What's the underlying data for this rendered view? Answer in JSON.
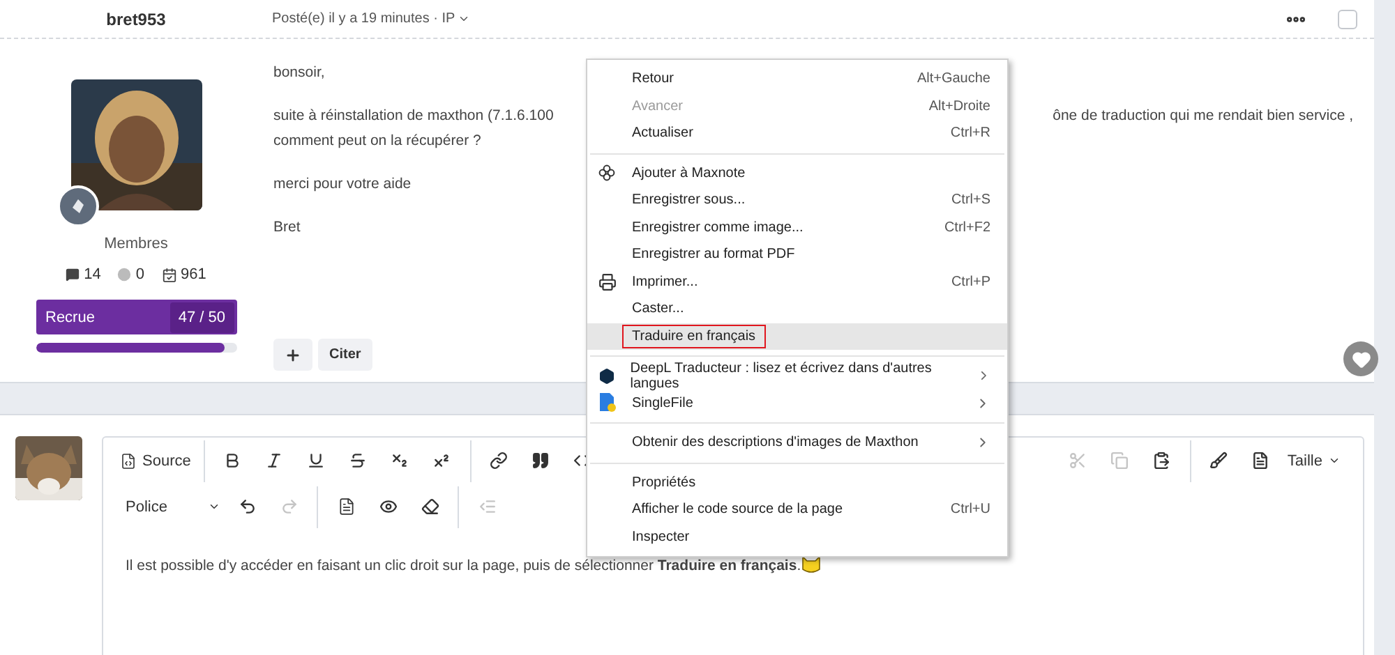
{
  "post": {
    "author": "bret953",
    "meta": "Posté(e) il y a 19 minutes · IP",
    "checked": false,
    "group": "Membres",
    "stats": [
      {
        "kind": "posts",
        "value": "14"
      },
      {
        "kind": "reputation",
        "value": "0"
      },
      {
        "kind": "days",
        "value": "961"
      }
    ],
    "rank": {
      "label": "Recrue",
      "count": "47 / 50",
      "level": 0.94
    },
    "greeting": "bonsoir,",
    "line_left": "suite à réinstallation de maxthon (7.1.6.100",
    "line_right": "ône de traduction qui me rendait bien service ,",
    "line_next": "comment peut on la récupérer ?",
    "paragraphs": [
      "merci pour votre aide",
      "Bret"
    ],
    "quote_button": "Citer",
    "liked": false
  },
  "context_menu": {
    "items": [
      {
        "kind": "item",
        "label": "Retour",
        "shortcut": "Alt+Gauche",
        "disabled": false,
        "selected": false
      },
      {
        "kind": "item",
        "label": "Avancer",
        "shortcut": "Alt+Droite",
        "disabled": true,
        "selected": false
      },
      {
        "kind": "item",
        "label": "Actualiser",
        "shortcut": "Ctrl+R",
        "disabled": false,
        "selected": false
      },
      {
        "kind": "separator"
      },
      {
        "kind": "item",
        "label": "Ajouter à Maxnote",
        "disabled": false,
        "selected": false
      },
      {
        "kind": "item",
        "label": "Enregistrer sous...",
        "shortcut": "Ctrl+S",
        "disabled": false,
        "selected": false
      },
      {
        "kind": "item",
        "label": "Enregistrer comme image...",
        "shortcut": "Ctrl+F2",
        "disabled": false,
        "selected": false
      },
      {
        "kind": "item",
        "label": "Enregistrer au format PDF",
        "disabled": false,
        "selected": false
      },
      {
        "kind": "item",
        "label": "Imprimer...",
        "shortcut": "Ctrl+P",
        "disabled": false,
        "selected": false
      },
      {
        "kind": "item",
        "label": "Caster...",
        "disabled": false,
        "selected": false
      },
      {
        "kind": "item",
        "label": "Traduire en français",
        "disabled": false,
        "selected": true,
        "outlined": true
      },
      {
        "kind": "separator"
      },
      {
        "kind": "item",
        "label": "DeepL Traducteur : lisez et écrivez dans d'autres langues",
        "submenu": true,
        "disabled": false,
        "selected": false
      },
      {
        "kind": "item",
        "label": "SingleFile",
        "submenu": true,
        "disabled": false,
        "selected": false
      },
      {
        "kind": "separator"
      },
      {
        "kind": "item",
        "label": "Obtenir des descriptions d'images de Maxthon",
        "submenu": true,
        "disabled": false,
        "selected": false
      },
      {
        "kind": "separator"
      },
      {
        "kind": "item",
        "label": "Propriétés",
        "disabled": false,
        "selected": false
      },
      {
        "kind": "item",
        "label": "Afficher le code source de la page",
        "shortcut": "Ctrl+U",
        "disabled": false,
        "selected": false
      },
      {
        "kind": "item",
        "label": "Inspecter",
        "disabled": false,
        "selected": false
      }
    ]
  },
  "editor": {
    "toolbar_left": [
      {
        "kind": "source",
        "label": "Source",
        "disabled": false
      },
      {
        "kind": "sep"
      },
      {
        "kind": "bold",
        "disabled": false
      },
      {
        "kind": "italic",
        "disabled": false
      },
      {
        "kind": "underline",
        "disabled": false
      },
      {
        "kind": "strike",
        "disabled": false
      },
      {
        "kind": "subscript",
        "disabled": false
      },
      {
        "kind": "superscript",
        "disabled": false
      },
      {
        "kind": "sep"
      },
      {
        "kind": "link",
        "disabled": false
      },
      {
        "kind": "quote",
        "disabled": false
      },
      {
        "kind": "code",
        "disabled": false
      }
    ],
    "toolbar_right": [
      {
        "kind": "cut",
        "disabled": true
      },
      {
        "kind": "copy",
        "disabled": true
      },
      {
        "kind": "paste",
        "disabled": false
      },
      {
        "kind": "sep"
      },
      {
        "kind": "brush",
        "disabled": false
      },
      {
        "kind": "template",
        "disabled": false
      },
      {
        "kind": "size",
        "label": "Taille",
        "disabled": false
      }
    ],
    "toolbar_row2": [
      {
        "kind": "font",
        "label": "Police",
        "disabled": false
      },
      {
        "kind": "undo",
        "disabled": false
      },
      {
        "kind": "redo",
        "disabled": true
      },
      {
        "kind": "sep"
      },
      {
        "kind": "preview_doc",
        "disabled": false
      },
      {
        "kind": "eye",
        "disabled": false
      },
      {
        "kind": "eraser",
        "disabled": false
      },
      {
        "kind": "sep"
      },
      {
        "kind": "outdent",
        "disabled": true
      }
    ],
    "text": "Il est possible d'y accéder en faisant un clic droit sur la page, puis de sélectionner **Traduire en français**."
  }
}
